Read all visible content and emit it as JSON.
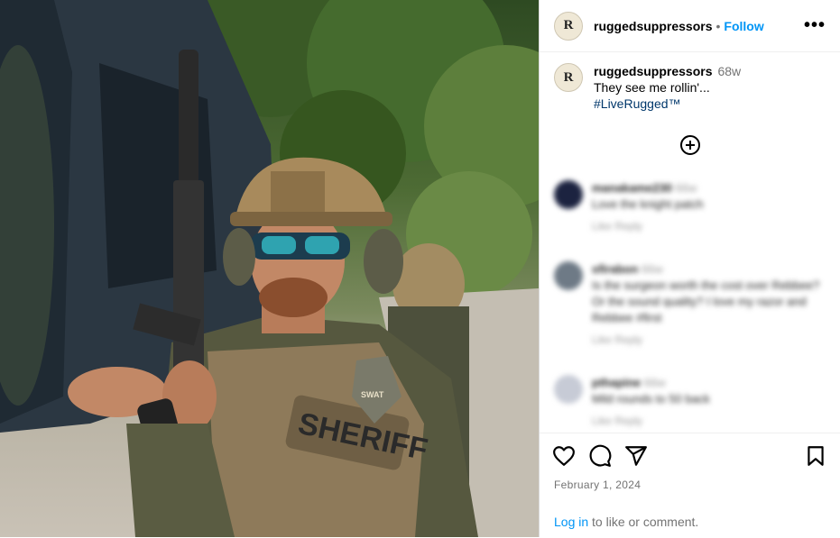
{
  "post": {
    "username": "ruggedsuppressors",
    "follow_label": "Follow",
    "separator": "•",
    "more_label": "•••",
    "avatar_letter": "R"
  },
  "caption": {
    "username": "ruggedsuppressors",
    "age": "68w",
    "text": "They see me rollin'...",
    "hashtag": "#LiveRugged™"
  },
  "photo": {
    "patch_text": "SHERIFF",
    "swat_text": "SWAT"
  },
  "comments": [
    {
      "user": "manakame230",
      "age": "66w",
      "text": "Love the knight patch",
      "meta": "Like   Reply",
      "color": "#1c2340"
    },
    {
      "user": "sfirabon",
      "age": "66w",
      "text": "Is the surgeon worth the cost over Rebbee? Or the sound quality? I love my razor and Rebbee #first",
      "meta": "Like   Reply",
      "color": "#6e7a86"
    },
    {
      "user": "pthapine",
      "age": "66w",
      "text": "Mild rounds to 50 back",
      "meta": "Like   Reply",
      "color": "#c7cbd6"
    }
  ],
  "footer": {
    "date": "February 1, 2024",
    "login_link": "Log in",
    "login_rest": " to like or comment."
  },
  "icons": [
    "heart-icon",
    "comment-icon",
    "share-icon",
    "bookmark-icon",
    "add-circle-icon"
  ]
}
